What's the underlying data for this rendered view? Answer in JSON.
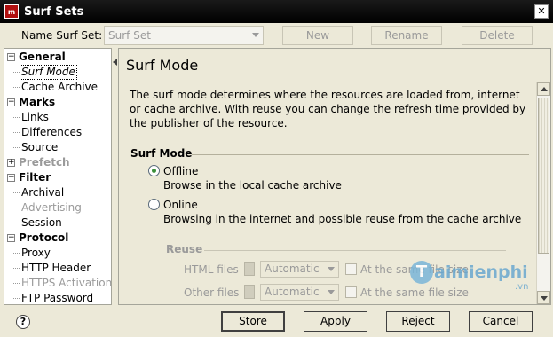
{
  "window": {
    "title": "Surf Sets",
    "app_icon_text": "m"
  },
  "toolbar": {
    "name_label": "Name Surf Set:",
    "surf_set_value": "Surf Set",
    "new_label": "New",
    "rename_label": "Rename",
    "delete_label": "Delete"
  },
  "tree": {
    "general": {
      "label": "General",
      "expander": "−"
    },
    "surf_mode": "Surf Mode",
    "cache_archive": "Cache Archive",
    "marks": {
      "label": "Marks",
      "expander": "−"
    },
    "links": "Links",
    "differences": "Differences",
    "source": "Source",
    "prefetch": {
      "label": "Prefetch",
      "expander": "+"
    },
    "filter": {
      "label": "Filter",
      "expander": "−"
    },
    "archival": "Archival",
    "advertising": "Advertising",
    "session": "Session",
    "protocol": {
      "label": "Protocol",
      "expander": "−"
    },
    "proxy": "Proxy",
    "http_header": "HTTP Header",
    "https_activation": "HTTPS Activation",
    "ftp_password": "FTP Password"
  },
  "content": {
    "title": "Surf Mode",
    "description": "The surf mode determines where the resources are loaded from, internet or cache archive. With reuse you can change the refresh time provided by the publisher of the resource.",
    "group_title": "Surf Mode",
    "offline_label": "Offline",
    "offline_desc": "Browse in the local cache archive",
    "online_label": "Online",
    "online_desc": "Browsing in the internet and possible reuse from the cache archive",
    "reuse_title": "Reuse",
    "html_files_label": "HTML files",
    "html_files_value": "Automatic",
    "html_same_size": "At the same file size",
    "other_files_label": "Other files",
    "other_files_value": "Automatic",
    "other_same_size": "At the same file size"
  },
  "footer": {
    "help": "?",
    "store": "Store",
    "apply": "Apply",
    "reject": "Reject",
    "cancel": "Cancel"
  },
  "watermark": {
    "letter": "T",
    "text": "aimienphi",
    "suffix": ".vn"
  }
}
